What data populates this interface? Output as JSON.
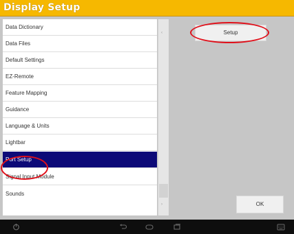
{
  "window": {
    "title": "Display Setup"
  },
  "list": {
    "items": [
      {
        "label": "Data Dictionary"
      },
      {
        "label": "Data Files"
      },
      {
        "label": "Default Settings"
      },
      {
        "label": "EZ-Remote"
      },
      {
        "label": "Feature Mapping"
      },
      {
        "label": "Guidance"
      },
      {
        "label": "Language & Units"
      },
      {
        "label": "Lightbar"
      },
      {
        "label": "Port Setup",
        "selected": true
      },
      {
        "label": "Signal Input Module"
      },
      {
        "label": "Sounds"
      }
    ]
  },
  "buttons": {
    "setup_label": "Setup",
    "ok_label": "OK"
  },
  "scrollbar": {
    "up_glyph": "‹",
    "down_glyph": "›"
  },
  "navbar": {
    "icons": [
      "power-icon",
      "back-icon",
      "home-icon",
      "recent-apps-icon",
      "keyboard-icon"
    ]
  },
  "colors": {
    "title_bar": "#f6b800",
    "selected_row": "#0d0a78",
    "highlight_ring": "#e0101a",
    "panel_background": "#c6c6c6",
    "nav_bar": "#0e0e0e"
  }
}
